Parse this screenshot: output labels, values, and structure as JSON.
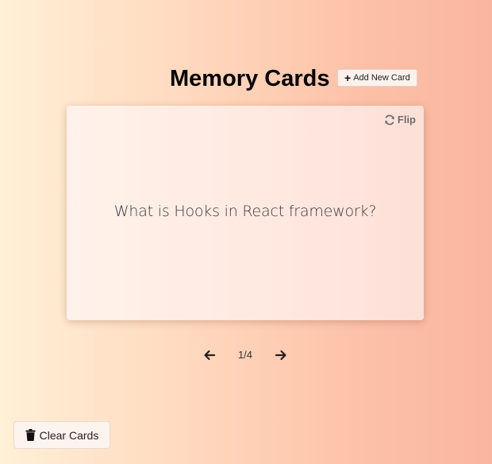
{
  "header": {
    "title": "Memory Cards",
    "add_button": {
      "icon": "plus-icon",
      "label": "Add New Card"
    }
  },
  "card": {
    "flip_button": {
      "icon": "sync-icon",
      "label": "Flip"
    },
    "question": "What is Hooks in React framework?"
  },
  "navigation": {
    "prev_icon": "arrow-left-icon",
    "next_icon": "arrow-right-icon",
    "counter": "1/4"
  },
  "footer": {
    "clear_button": {
      "icon": "trash-icon",
      "label": "Clear Cards"
    }
  },
  "colors": {
    "background_start": "#fff0d6",
    "background_end": "#fab5a0",
    "card_bg": "#fff2ea",
    "text_primary": "#111111",
    "flip_gray": "#6e6e6e"
  }
}
